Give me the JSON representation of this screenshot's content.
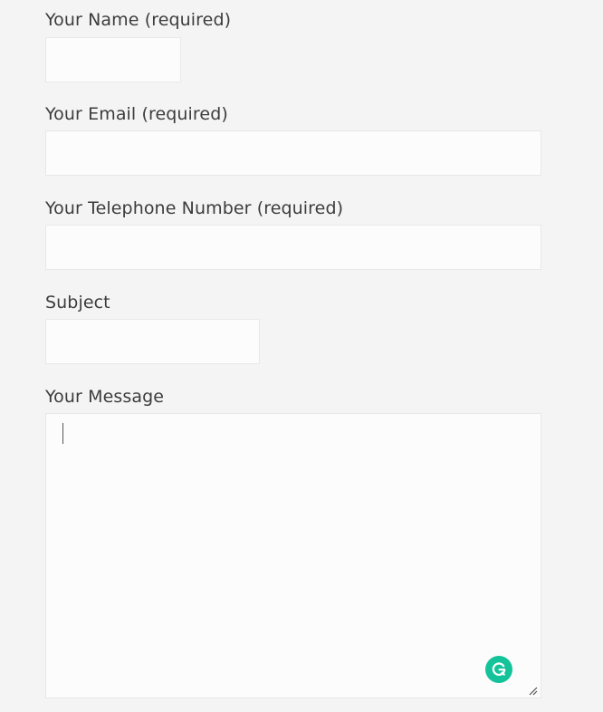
{
  "form": {
    "name_label": "Your Name (required)",
    "email_label": "Your Email (required)",
    "phone_label": "Your Telephone Number (required)",
    "subject_label": "Subject",
    "message_label": "Your Message",
    "name_value": "",
    "email_value": "",
    "phone_value": "",
    "subject_value": "",
    "message_value": ""
  },
  "icons": {
    "grammarly": "grammarly-icon",
    "resize": "resize-handle-icon"
  },
  "colors": {
    "background": "#f4f4f4",
    "field_background": "#fcfcfc",
    "field_border": "#e8e8e8",
    "grammarly_accent": "#15c39a"
  }
}
